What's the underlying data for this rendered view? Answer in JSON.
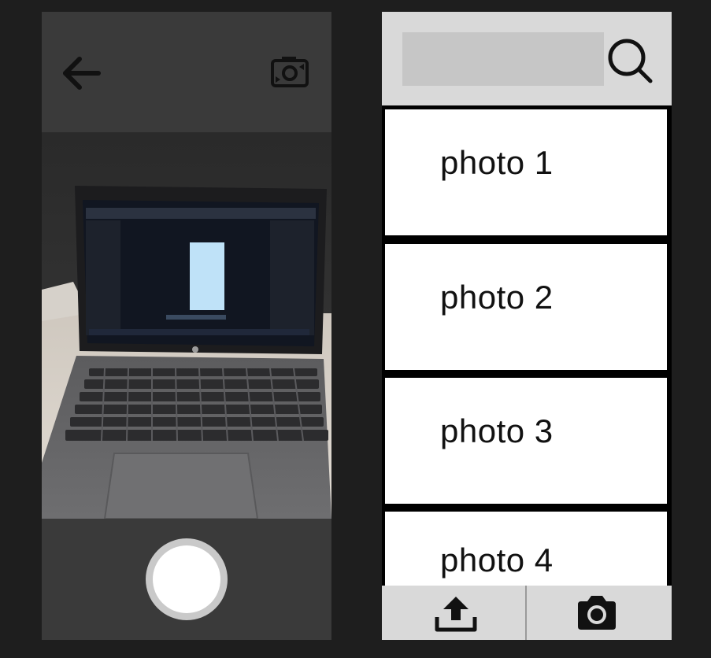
{
  "camera_screen": {
    "back_icon": "arrow-left-icon",
    "flip_icon": "camera-flip-icon",
    "viewfinder_content": "laptop-photo",
    "shutter_icon": "shutter-button"
  },
  "gallery_screen": {
    "search": {
      "value": "",
      "placeholder": "",
      "icon": "search-icon"
    },
    "photos": [
      {
        "label": "photo 1"
      },
      {
        "label": "photo 2"
      },
      {
        "label": "photo 3"
      },
      {
        "label": "photo 4"
      }
    ],
    "bottom_nav": {
      "upload_icon": "upload-icon",
      "camera_icon": "camera-icon"
    }
  },
  "colors": {
    "background": "#1e1e1e",
    "phone_panel": "#3a3a3a",
    "gallery_bar": "#d9d9d9",
    "search_field": "#c6c6c6",
    "list_item": "#ffffff"
  }
}
